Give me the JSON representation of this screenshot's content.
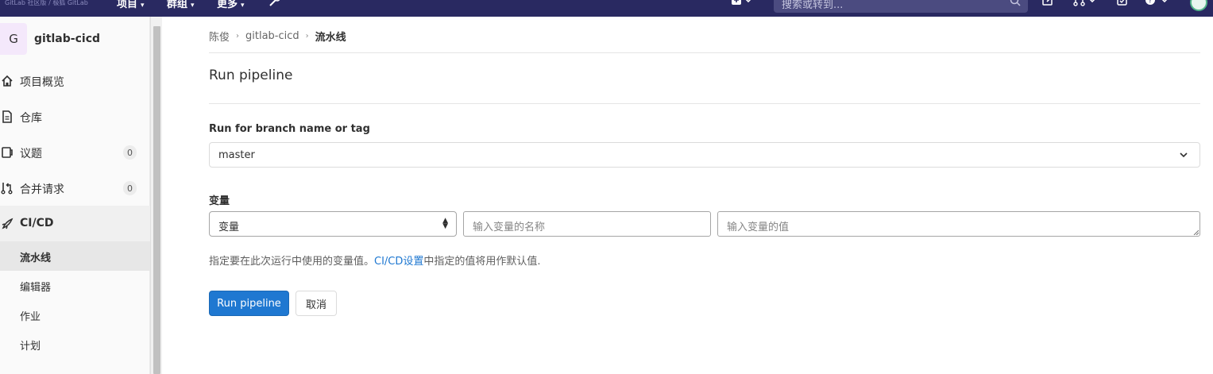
{
  "navbar": {
    "logo_text": "GitLab 社区版 / 极狐 GitLab",
    "links": [
      {
        "label": "项目",
        "caret": "▾"
      },
      {
        "label": "群组",
        "caret": "▾"
      },
      {
        "label": "更多",
        "caret": "▾"
      }
    ],
    "search_placeholder": "搜索或转到...",
    "icons": [
      "wrench-icon",
      "plus-square-icon",
      "search-icon",
      "edit-icon",
      "merge-request-icon",
      "todo-icon",
      "help-icon",
      "avatar"
    ]
  },
  "sidebar": {
    "project_avatar_letter": "G",
    "project_name": "gitlab-cicd",
    "items": [
      {
        "label": "项目概览",
        "icon": "home-icon"
      },
      {
        "label": "仓库",
        "icon": "doc-icon"
      },
      {
        "label": "议题",
        "icon": "issues-icon",
        "badge": "0"
      },
      {
        "label": "合并请求",
        "icon": "merge-request-icon",
        "badge": "0"
      },
      {
        "label": "CI/CD",
        "icon": "rocket-icon",
        "active": true
      }
    ],
    "subitems": [
      {
        "label": "流水线",
        "active": true
      },
      {
        "label": "编辑器"
      },
      {
        "label": "作业"
      },
      {
        "label": "计划"
      }
    ]
  },
  "breadcrumb": {
    "items": [
      "陈俊",
      "gitlab-cicd",
      "流水线"
    ],
    "separator": "›"
  },
  "page": {
    "title": "Run pipeline",
    "branch_label": "Run for branch name or tag",
    "branch_value": "master",
    "variables_label": "变量",
    "variable_type": "变量",
    "variable_name_placeholder": "输入变量的名称",
    "variable_value_placeholder": "输入变量的值",
    "help_prefix": "指定要在此次运行中使用的变量值。",
    "help_link": "CI/CD设置",
    "help_suffix": "中指定的值将用作默认值.",
    "run_button": "Run pipeline",
    "cancel_button": "取消"
  },
  "colors": {
    "navbar_bg": "#292961",
    "primary": "#1f78d1",
    "link": "#1f78d1"
  }
}
